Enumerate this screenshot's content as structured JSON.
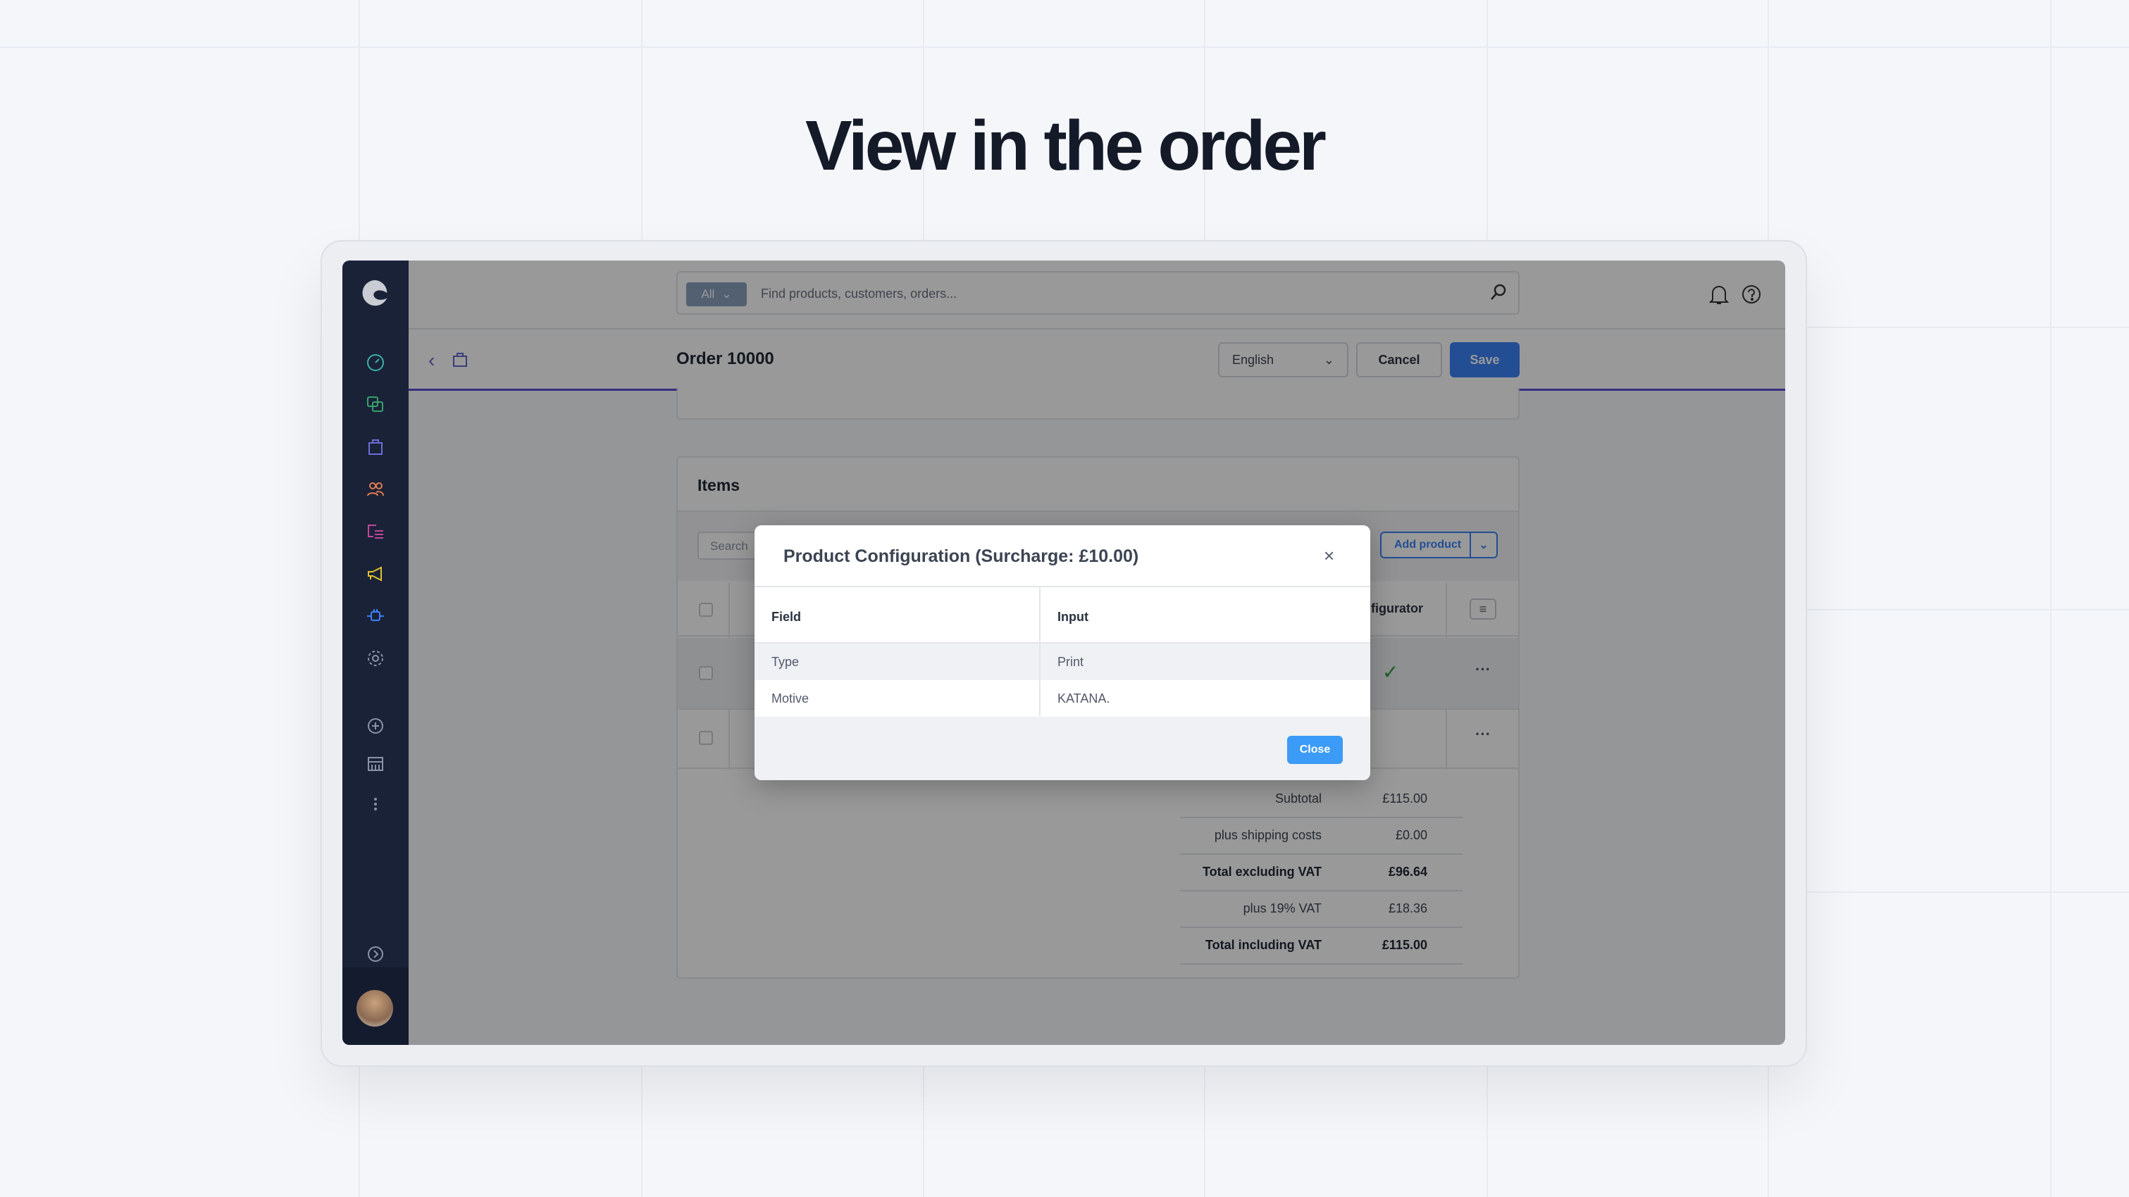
{
  "headline": "View in the order",
  "search": {
    "scope": "All",
    "placeholder": "Find products, customers, orders..."
  },
  "header": {
    "title": "Order 10000",
    "language": "English",
    "cancel_label": "Cancel",
    "save_label": "Save"
  },
  "sidebar": {
    "items": [
      {
        "icon": "dashboard-icon",
        "color": "#3bb0a8"
      },
      {
        "icon": "catalogue-icon",
        "color": "#38a169"
      },
      {
        "icon": "orders-icon",
        "color": "#6b6fd6"
      },
      {
        "icon": "customers-icon",
        "color": "#e07c4c"
      },
      {
        "icon": "content-icon",
        "color": "#c2469a"
      },
      {
        "icon": "marketing-icon",
        "color": "#e0c22c"
      },
      {
        "icon": "extensions-icon",
        "color": "#3b82f6"
      },
      {
        "icon": "settings-icon",
        "color": "#8a93a6"
      }
    ]
  },
  "items": {
    "title": "Items",
    "search_placeholder": "Search",
    "add_product_label": "Add product",
    "column_configurator": "figurator",
    "rows": [
      {
        "configurator": true
      },
      {
        "configurator": false
      }
    ],
    "totals": [
      {
        "label": "Subtotal",
        "value": "£115.00",
        "bold": false
      },
      {
        "label": "plus shipping costs",
        "value": "£0.00",
        "bold": false
      },
      {
        "label": "Total excluding VAT",
        "value": "£96.64",
        "bold": true
      },
      {
        "label": "plus 19% VAT",
        "value": "£18.36",
        "bold": false
      },
      {
        "label": "Total including VAT",
        "value": "£115.00",
        "bold": true
      }
    ]
  },
  "modal": {
    "title": "Product Configuration (Surcharge: £10.00)",
    "columns": [
      "Field",
      "Input"
    ],
    "rows": [
      {
        "field": "Type",
        "input": "Print"
      },
      {
        "field": "Motive",
        "input": "KATANA."
      }
    ],
    "close_label": "Close"
  },
  "colors": {
    "accent": "#3b82f6",
    "sidebar": "#1a2238",
    "nav_line": "#5b4fd6"
  }
}
